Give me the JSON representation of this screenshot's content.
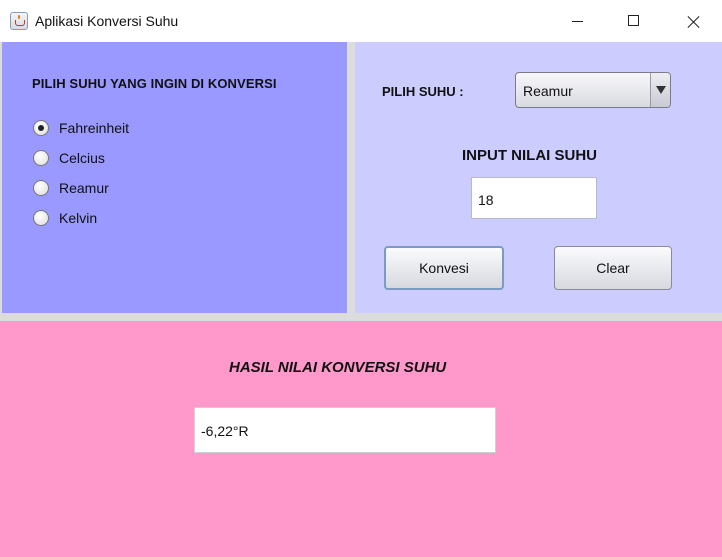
{
  "window": {
    "title": "Aplikasi Konversi Suhu",
    "icon": "java-cup-icon"
  },
  "left_panel": {
    "heading": "PILIH SUHU YANG INGIN DI KONVERSI",
    "background": "#9999ff",
    "options": [
      {
        "label": "Fahreinheit",
        "checked": true
      },
      {
        "label": "Celcius",
        "checked": false
      },
      {
        "label": "Reamur",
        "checked": false
      },
      {
        "label": "Kelvin",
        "checked": false
      }
    ]
  },
  "right_panel": {
    "background": "#ccccff",
    "pilih_label": "PILIH SUHU :",
    "dropdown_value": "Reamur",
    "input_heading": "INPUT NILAI SUHU",
    "input_value": "18",
    "convert_button": "Konvesi",
    "clear_button": "Clear"
  },
  "bottom_panel": {
    "background": "#ff99cc",
    "heading": "HASIL NILAI KONVERSI SUHU",
    "result_value": "-6,22°R"
  }
}
